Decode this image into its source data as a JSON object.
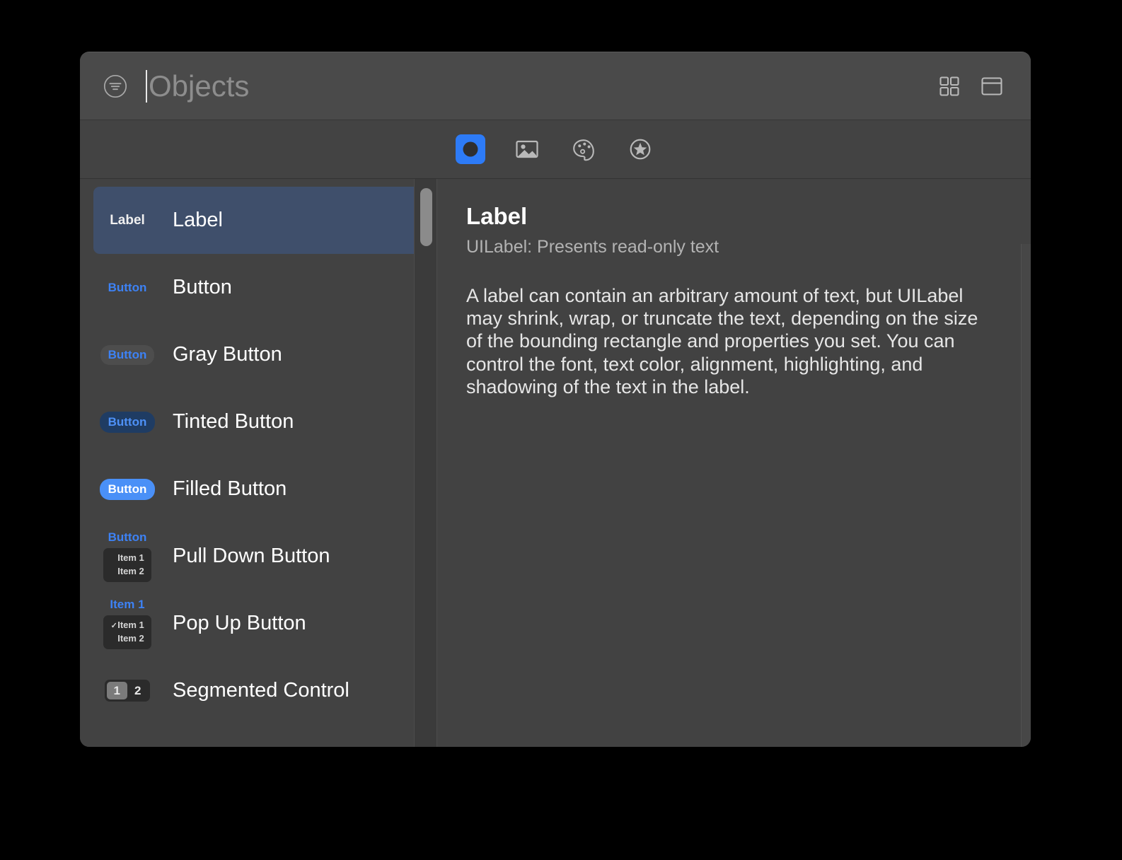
{
  "window": {
    "title_placeholder": "Objects",
    "filter_icon": "filter-lines-circle-icon",
    "caret_visible": true
  },
  "header": {
    "actions": [
      {
        "name": "grid-view-button",
        "icon": "grid-view-icon",
        "label": "Grid View"
      },
      {
        "name": "detail-view-button",
        "icon": "detail-view-icon",
        "label": "Detail View"
      }
    ]
  },
  "tabs": [
    {
      "id": "objects",
      "icon": "objects-icon",
      "label": "Objects",
      "active": true
    },
    {
      "id": "media",
      "icon": "photo-icon",
      "label": "Media",
      "active": false
    },
    {
      "id": "colors",
      "icon": "palette-icon",
      "label": "Colors",
      "active": false
    },
    {
      "id": "symbols",
      "icon": "star-circle-icon",
      "label": "Symbols",
      "active": false
    }
  ],
  "list": {
    "selected_index": 0,
    "items": [
      {
        "title": "Label",
        "preview_type": "plain-label",
        "preview_text": "Label"
      },
      {
        "title": "Button",
        "preview_type": "btn-plain",
        "preview_text": "Button"
      },
      {
        "title": "Gray Button",
        "preview_type": "btn-gray",
        "preview_text": "Button"
      },
      {
        "title": "Tinted Button",
        "preview_type": "btn-tinted",
        "preview_text": "Button"
      },
      {
        "title": "Filled Button",
        "preview_type": "btn-filled",
        "preview_text": "Button"
      },
      {
        "title": "Pull Down Button",
        "preview_type": "menu",
        "preview_text": "Button",
        "menu_items": [
          "Item 1",
          "Item 2"
        ],
        "checked_index": -1
      },
      {
        "title": "Pop Up Button",
        "preview_type": "menu",
        "preview_text": "Item 1",
        "menu_items": [
          "Item 1",
          "Item 2"
        ],
        "checked_index": 0
      },
      {
        "title": "Segmented Control",
        "preview_type": "segmented",
        "preview_text": "",
        "segments": [
          "1",
          "2"
        ],
        "selected_segment": 0
      }
    ]
  },
  "detail": {
    "title": "Label",
    "subtitle": "UILabel: Presents read-only text",
    "body": "A label can contain an arbitrary amount of text, but UILabel may shrink, wrap, or truncate the text, depending on the size of the bounding rectangle and properties you set. You can control the font, text color, alignment, highlighting, and shadowing of the text in the label."
  },
  "colors": {
    "window_background": "#424242",
    "header_background": "#4a4a4a",
    "selection_blue": "#3f4f6b",
    "accent_blue": "#2d7bf7",
    "button_blue": "#3d82f5",
    "filled_blue": "#4a90f7",
    "tinted_background": "#1f3c63",
    "menu_background": "#2b2b2b",
    "scroll_thumb": "#8b8b8b"
  }
}
